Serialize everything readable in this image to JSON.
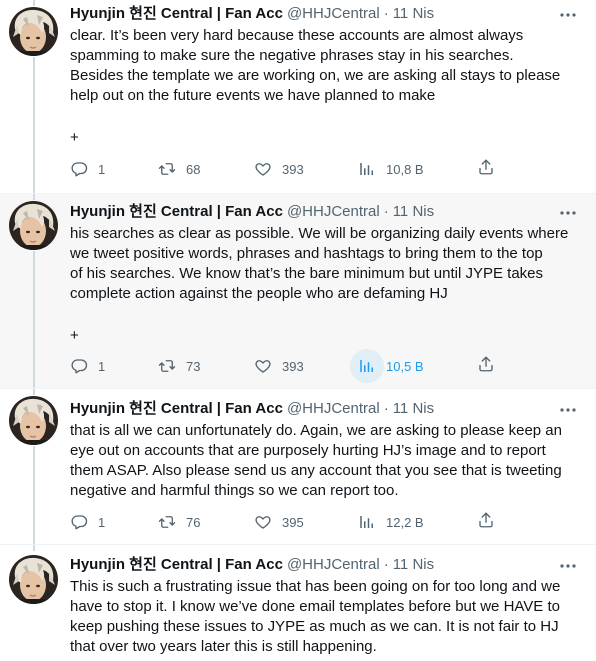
{
  "colors": {
    "text": "#0f1419",
    "secondary": "#536471",
    "accent": "#1d9bf0",
    "divider": "#eff3f4",
    "thread_line": "#cfd9de",
    "hover_bg": "#f7f7f7"
  },
  "tweets": [
    {
      "author_name": "Hyunjin 현진 Central | Fan Acc",
      "handle": "@HHJCentral",
      "dot": "·",
      "time": "11 Nis",
      "text": "clear. It’s been very hard because these accounts are almost always\nspamming to make sure the negative phrases stay in his searches.\nBesides the template we are working on, we are asking all stays to please\nhelp out on the future events we have planned to make",
      "more_text": "+",
      "replies": "1",
      "retweets": "68",
      "likes": "393",
      "views": "10,8 B",
      "icons": [
        "reply-icon",
        "retweet-icon",
        "like-icon",
        "views-icon",
        "share-icon"
      ]
    },
    {
      "author_name": "Hyunjin 현진 Central | Fan Acc",
      "handle": "@HHJCentral",
      "dot": "·",
      "time": "11 Nis",
      "text": "his searches as clear as possible. We will be organizing daily events where\nwe tweet positive words, phrases and hashtags to bring them to the top\nof his searches. We know that’s the bare minimum but until JYPE takes\ncomplete action against the people who are defaming HJ",
      "more_text": "+",
      "replies": "1",
      "retweets": "73",
      "likes": "393",
      "views": "10,5 B"
    },
    {
      "author_name": "Hyunjin 현진 Central | Fan Acc",
      "handle": "@HHJCentral",
      "dot": "·",
      "time": "11 Nis",
      "text": "that is all we can unfortunately do. Again, we are asking to please keep an\neye out on accounts that are purposely hurting HJ’s image and to report\nthem ASAP. Also please send us any account that you see that is tweeting\nnegative and harmful things so we can report too.",
      "replies": "1",
      "retweets": "76",
      "likes": "395",
      "views": "12,2 B"
    },
    {
      "author_name": "Hyunjin 현진 Central | Fan Acc",
      "handle": "@HHJCentral",
      "dot": "·",
      "time": "11 Nis",
      "text": "This is such a frustrating issue that has been going on for too long and we\nhave to stop it. I know we’ve done email templates before but we HAVE to\nkeep pushing these issues to JYPE as much as we can. It is not fair to HJ\nthat over two years later this is still happening."
    }
  ]
}
